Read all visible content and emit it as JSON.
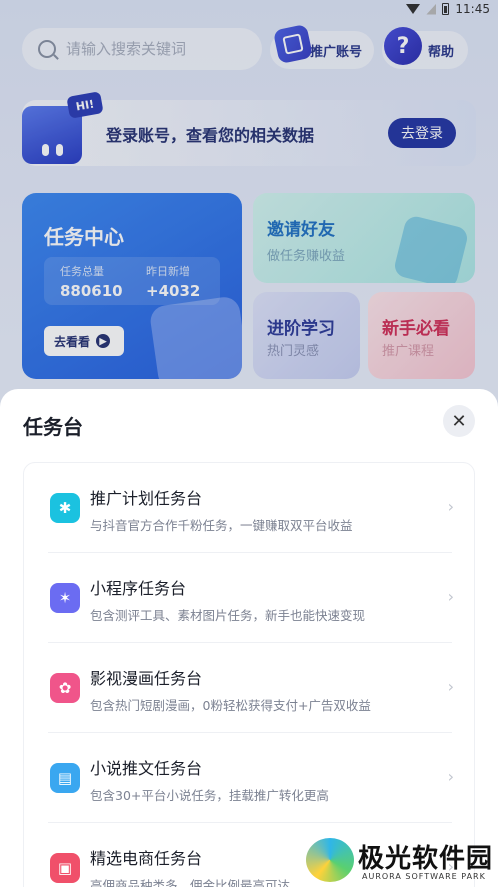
{
  "status_bar": {
    "time": "11:45"
  },
  "search": {
    "placeholder": "请输入搜索关键词"
  },
  "header": {
    "promo_label": "推广账号",
    "help_label": "帮助",
    "help_glyph": "?"
  },
  "login_banner": {
    "badge": "HI!",
    "text": "登录账号，查看您的相关数据",
    "button": "去登录"
  },
  "task_center": {
    "title": "任务中心",
    "stats": [
      {
        "label": "任务总量",
        "value": "880610"
      },
      {
        "label": "昨日新增",
        "value": "+4032"
      }
    ],
    "button": "去看看"
  },
  "invite": {
    "title": "邀请好友",
    "subtitle": "做任务赚收益"
  },
  "study": {
    "title": "进阶学习",
    "subtitle": "热门灵感"
  },
  "newbie": {
    "title": "新手必看",
    "subtitle": "推广课程"
  },
  "sheet": {
    "title": "任务台",
    "items": [
      {
        "title": "推广计划任务台",
        "desc": "与抖音官方合作千粉任务，一键赚取双平台收益",
        "icon": "sparkle-icon",
        "color": "#1bc2e0"
      },
      {
        "title": "小程序任务台",
        "desc": "包含测评工具、素材图片任务，新手也能快速变现",
        "icon": "miniapp-icon",
        "color": "#6b6cf2"
      },
      {
        "title": "影视漫画任务台",
        "desc": "包含热门短剧漫画，0粉轻松获得支付+广告双收益",
        "icon": "film-reel-icon",
        "color": "#f0558a"
      },
      {
        "title": "小说推文任务台",
        "desc": "包含30+平台小说任务，挂载推广转化更高",
        "icon": "book-icon",
        "color": "#3aa7f0"
      },
      {
        "title": "精选电商任务台",
        "desc": "高佣商品种类多，佣金比例最高可达",
        "icon": "shopping-bag-icon",
        "color": "#f0506a"
      }
    ]
  },
  "watermark": {
    "name": "极光软件园",
    "en": "AURORA SOFTWARE PARK"
  }
}
